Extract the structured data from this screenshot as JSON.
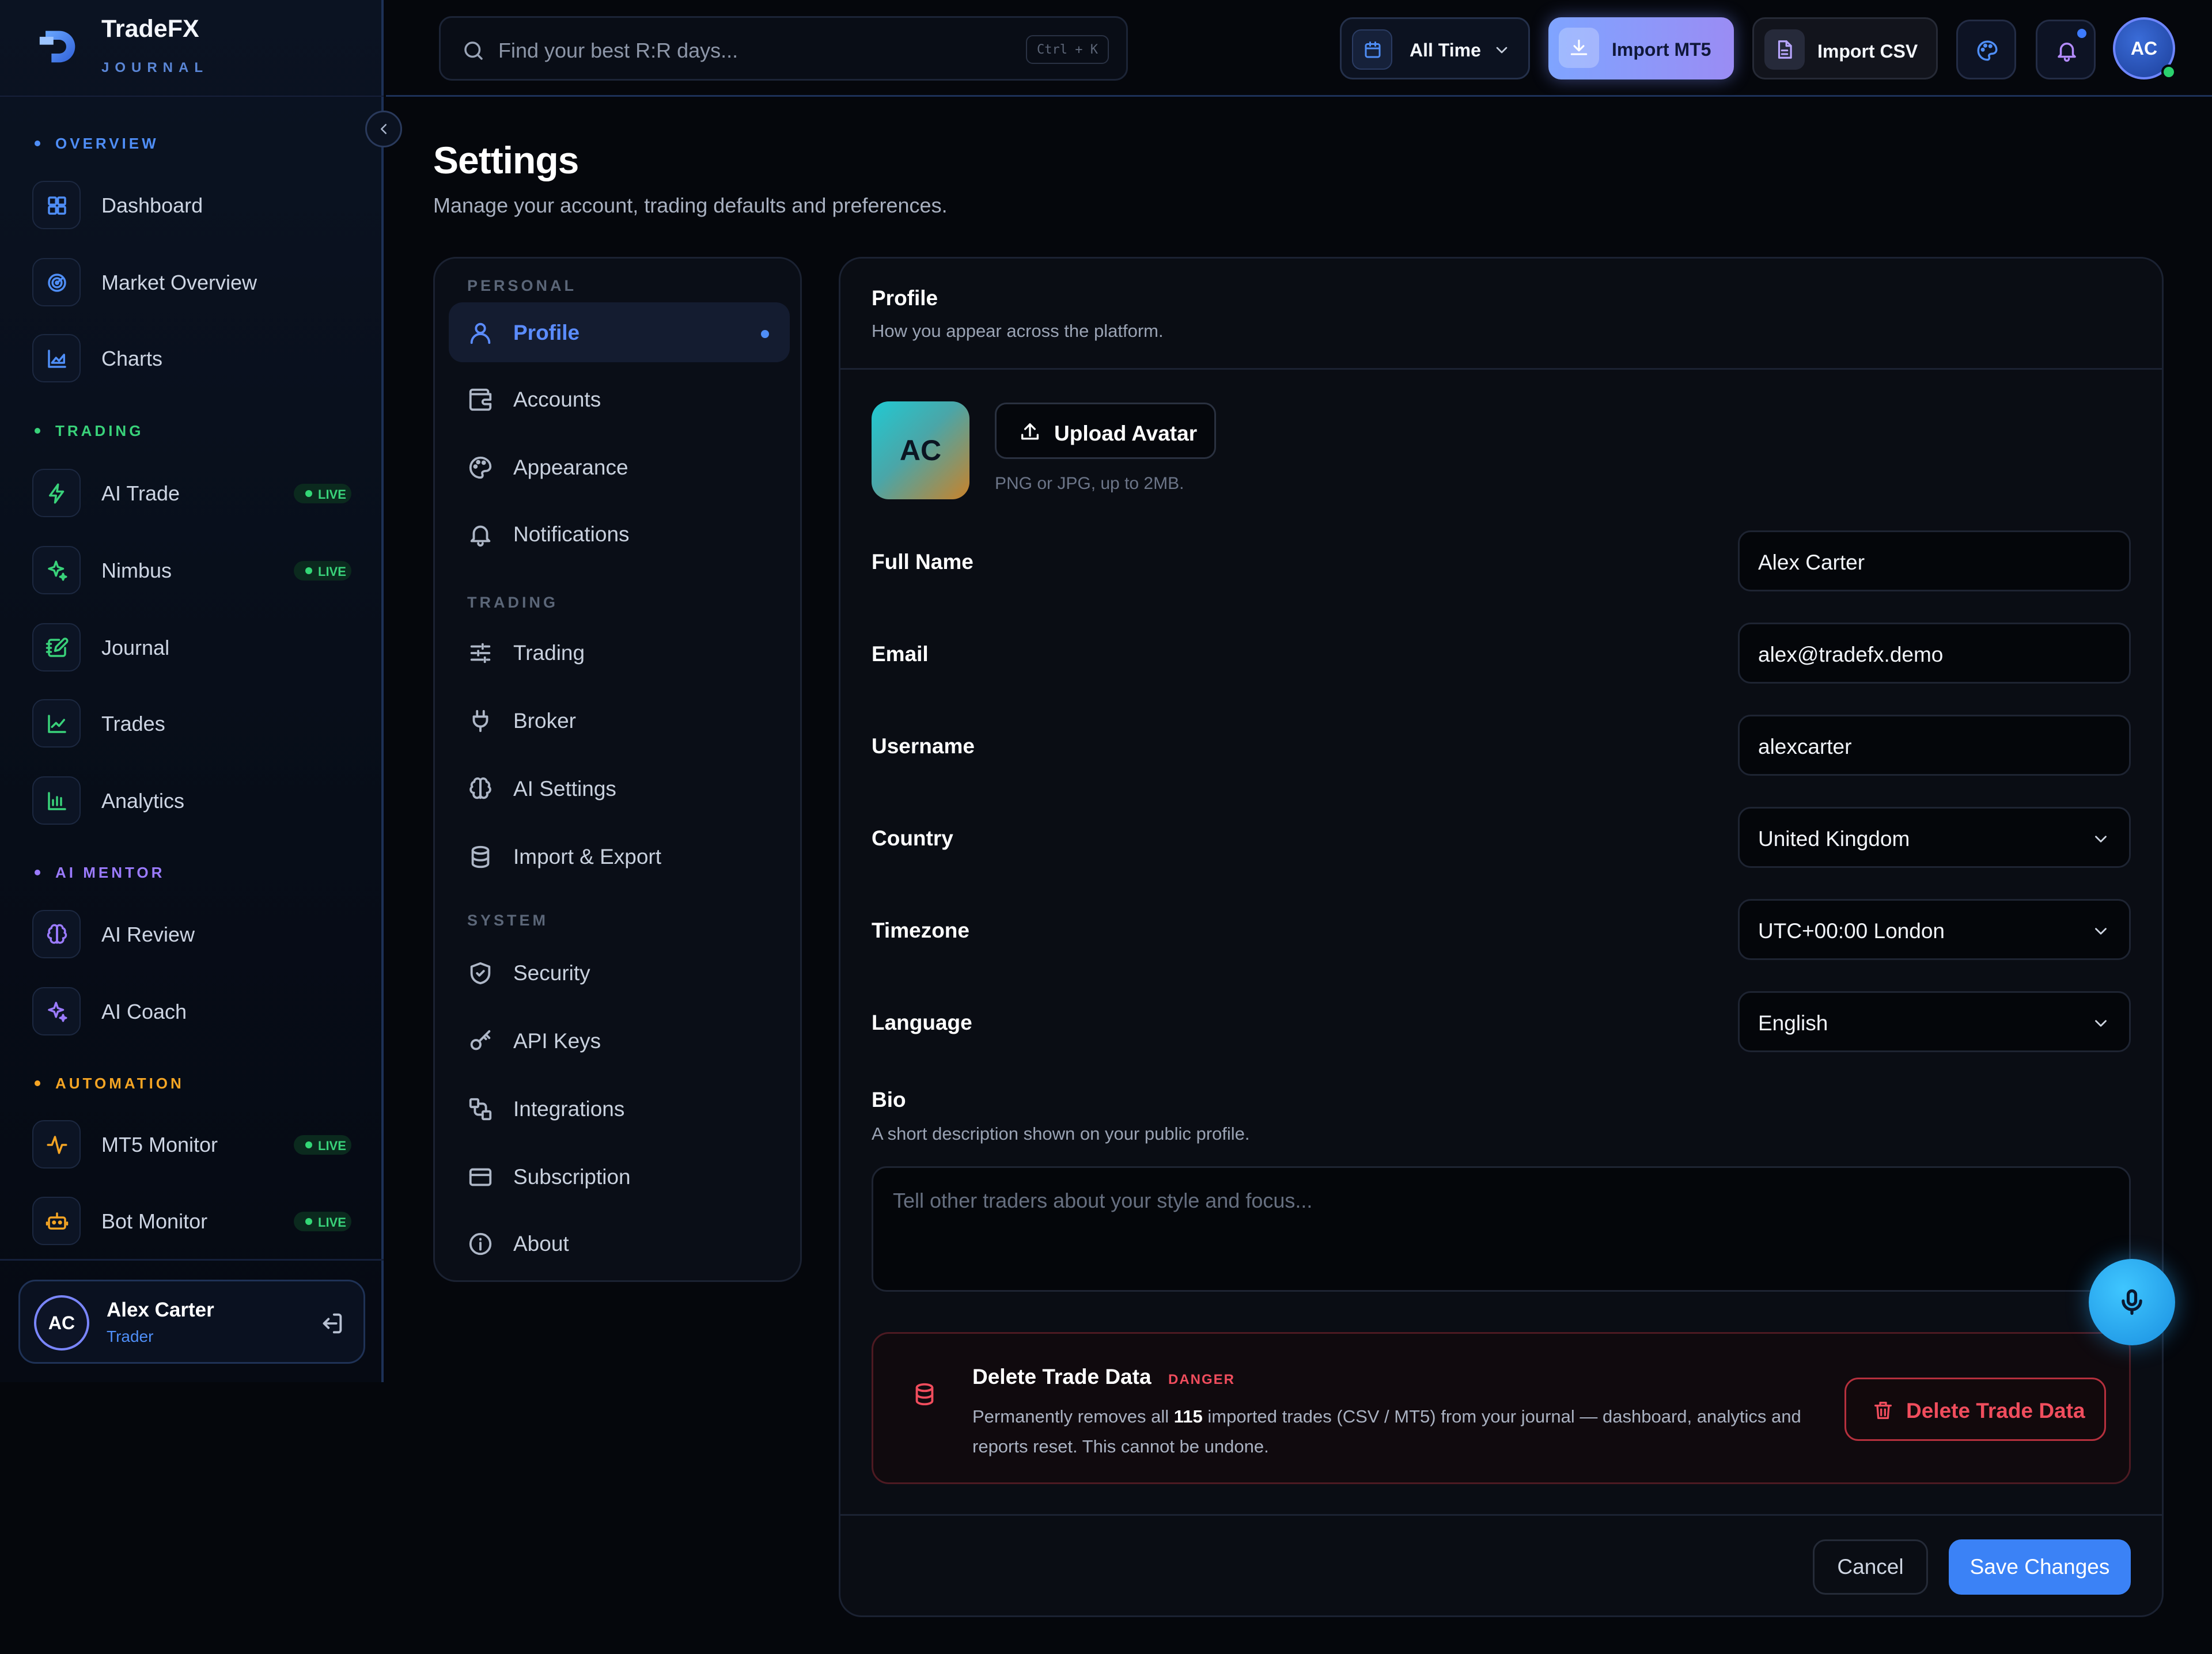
{
  "brand": {
    "name": "TradeFX",
    "sub": "JOURNAL"
  },
  "sidebar": {
    "sections": [
      {
        "title": "OVERVIEW",
        "color": "#4f8ef7"
      },
      {
        "title": "TRADING",
        "color": "#39d27a"
      },
      {
        "title": "AI MENTOR",
        "color": "#9b7bff"
      },
      {
        "title": "AUTOMATION",
        "color": "#f5a524"
      }
    ],
    "items": [
      {
        "label": "Dashboard",
        "icon": "grid-icon"
      },
      {
        "label": "Market Overview",
        "icon": "radar-icon"
      },
      {
        "label": "Charts",
        "icon": "chart-area-icon"
      },
      {
        "label": "AI Trade",
        "icon": "bolt-icon",
        "badge": "LIVE"
      },
      {
        "label": "Nimbus",
        "icon": "sparkles-icon",
        "badge": "LIVE"
      },
      {
        "label": "Journal",
        "icon": "notebook-pen-icon"
      },
      {
        "label": "Trades",
        "icon": "line-chart-icon"
      },
      {
        "label": "Analytics",
        "icon": "bar-chart-icon"
      },
      {
        "label": "AI Review",
        "icon": "brain-icon"
      },
      {
        "label": "AI Coach",
        "icon": "sparkles-icon"
      },
      {
        "label": "MT5 Monitor",
        "icon": "activity-icon",
        "badge": "LIVE"
      },
      {
        "label": "Bot Monitor",
        "icon": "bot-icon",
        "badge": "LIVE"
      }
    ],
    "user": {
      "initials": "AC",
      "name": "Alex Carter",
      "role": "Trader"
    }
  },
  "topbar": {
    "search_placeholder": "Find your best R:R days...",
    "shortcut": "Ctrl + K",
    "range": "All Time",
    "import_mt5": "Import MT5",
    "import_csv": "Import CSV",
    "avatar": "AC"
  },
  "page": {
    "title": "Settings",
    "subtitle": "Manage your account, trading defaults and preferences."
  },
  "settings_nav": {
    "groups": [
      "PERSONAL",
      "TRADING",
      "SYSTEM"
    ],
    "items": [
      {
        "label": "Profile",
        "icon": "user-icon",
        "active": true
      },
      {
        "label": "Accounts",
        "icon": "wallet-icon"
      },
      {
        "label": "Appearance",
        "icon": "palette-icon"
      },
      {
        "label": "Notifications",
        "icon": "bell-icon"
      },
      {
        "label": "Trading",
        "icon": "sliders-icon"
      },
      {
        "label": "Broker",
        "icon": "plug-icon"
      },
      {
        "label": "AI Settings",
        "icon": "brain-icon"
      },
      {
        "label": "Import & Export",
        "icon": "database-icon"
      },
      {
        "label": "Security",
        "icon": "shield-icon"
      },
      {
        "label": "API Keys",
        "icon": "key-icon"
      },
      {
        "label": "Integrations",
        "icon": "blocks-icon"
      },
      {
        "label": "Subscription",
        "icon": "credit-card-icon"
      },
      {
        "label": "About",
        "icon": "info-icon"
      }
    ]
  },
  "profile": {
    "title": "Profile",
    "subtitle": "How you appear across the platform.",
    "avatar_initials": "AC",
    "upload_label": "Upload Avatar",
    "upload_hint": "PNG or JPG, up to 2MB.",
    "fields": [
      {
        "label": "Full Name",
        "value": "Alex Carter",
        "type": "text"
      },
      {
        "label": "Email",
        "value": "alex@tradefx.demo",
        "type": "text"
      },
      {
        "label": "Username",
        "value": "alexcarter",
        "type": "text"
      },
      {
        "label": "Country",
        "value": "United Kingdom",
        "type": "select"
      },
      {
        "label": "Timezone",
        "value": "UTC+00:00 London",
        "type": "select"
      },
      {
        "label": "Language",
        "value": "English",
        "type": "select"
      }
    ],
    "bio": {
      "label": "Bio",
      "help": "A short description shown on your public profile.",
      "placeholder": "Tell other traders about your style and focus..."
    },
    "danger": {
      "title": "Delete Trade Data",
      "badge": "DANGER",
      "text_before": "Permanently removes all ",
      "count": "115",
      "text_after": " imported trades (CSV / MT5) from your journal — dashboard, analytics and reports reset. This cannot be undone.",
      "button": "Delete Trade Data"
    },
    "cancel": "Cancel",
    "save": "Save Changes"
  },
  "colors": {
    "accent": "#3b82f6",
    "danger": "#f04d5d",
    "live": "#39d27a",
    "background": "#05070c"
  }
}
